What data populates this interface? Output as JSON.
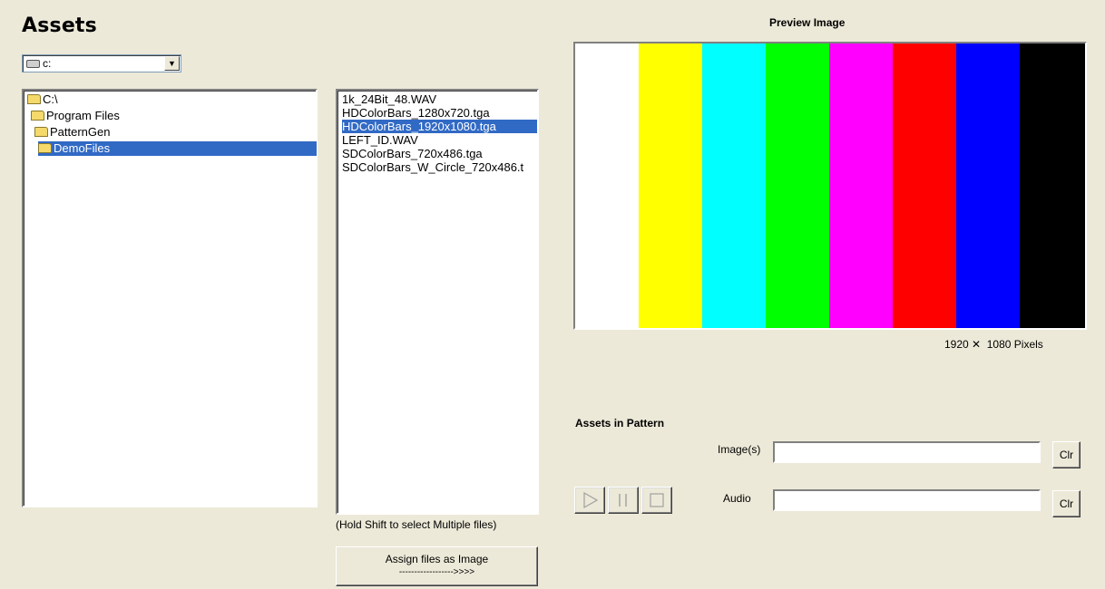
{
  "window": {
    "title": "Assets"
  },
  "drive_select": {
    "value": "c:"
  },
  "directory_tree": {
    "items": [
      {
        "label": "C:\\",
        "selected": false
      },
      {
        "label": "Program Files",
        "selected": false
      },
      {
        "label": "PatternGen",
        "selected": false
      },
      {
        "label": "DemoFiles",
        "selected": true
      }
    ]
  },
  "file_list": {
    "items": [
      {
        "label": "1k_24Bit_48.WAV",
        "selected": false
      },
      {
        "label": "HDColorBars_1280x720.tga",
        "selected": false
      },
      {
        "label": "HDColorBars_1920x1080.tga",
        "selected": true
      },
      {
        "label": "LEFT_ID.WAV",
        "selected": false
      },
      {
        "label": "SDColorBars_720x486.tga",
        "selected": false
      },
      {
        "label": "SDColorBars_W_Circle_720x486.t",
        "selected": false
      }
    ],
    "hint": "(Hold Shift to select Multiple files)"
  },
  "assign_button": {
    "label": "Assign files as Image",
    "arrow": "------------------>>>>"
  },
  "preview": {
    "title": "Preview Image",
    "bars": [
      "#FFFFFF",
      "#FFFF00",
      "#00FFFF",
      "#00FF00",
      "#FF00FF",
      "#FF0000",
      "#0000FF",
      "#000000"
    ],
    "resolution": "1920 ✕  1080 Pixels"
  },
  "assets_in_pattern": {
    "title": "Assets in Pattern",
    "image_label": "Image(s)",
    "image_value": "",
    "audio_label": "Audio",
    "audio_value": "",
    "clear_label": "Clr"
  },
  "transport": {
    "play_icon": "play-icon",
    "pause_icon": "pause-icon",
    "stop_icon": "stop-icon"
  }
}
